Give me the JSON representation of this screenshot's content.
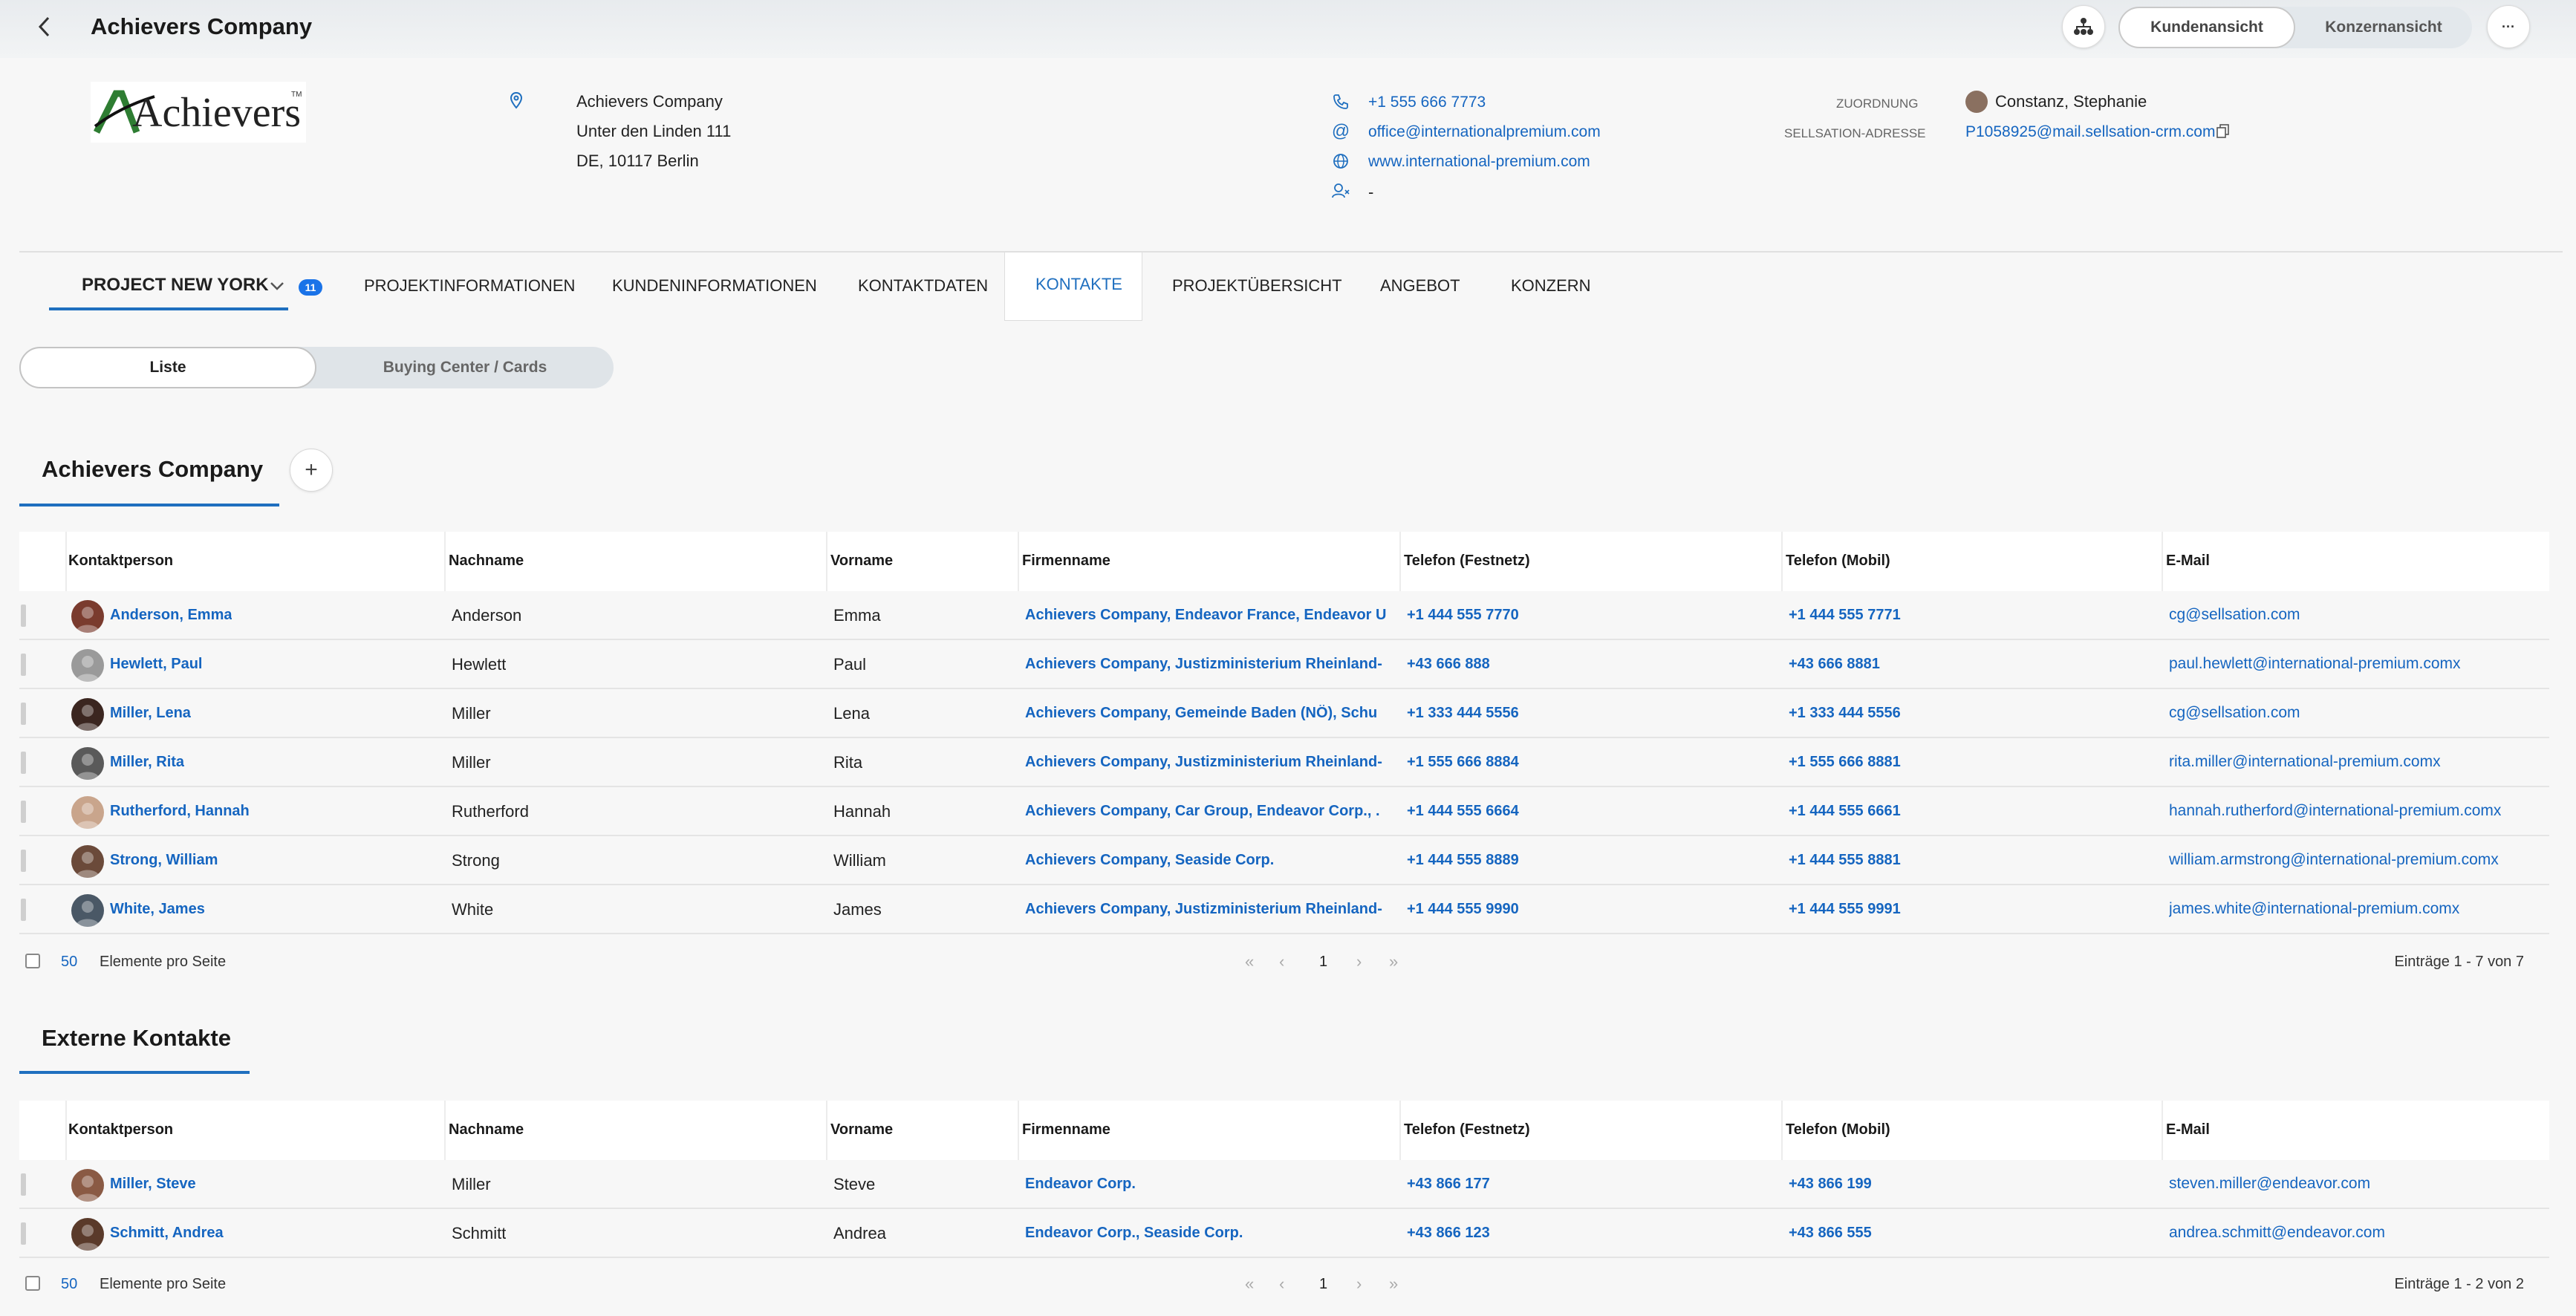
{
  "header": {
    "title": "Achievers Company",
    "view_toggle": [
      "Kundenansicht",
      "Konzernansicht"
    ],
    "more_label": "···"
  },
  "company": {
    "logo_text": "Achievers",
    "logo_tm": "TM",
    "address": [
      "Achievers Company",
      "Unter den Linden 111",
      "DE, 10117 Berlin"
    ],
    "phone": "+1 555 666 7773",
    "email": "office@internationalpremium.com",
    "website": "www.international-premium.com",
    "contact_person": "-",
    "assignment_label": "ZUORDNUNG",
    "assignment_value": "Constanz, Stephanie",
    "sellsation_label": "SELLSATION-ADRESSE",
    "sellsation_value": "P1058925@mail.sellsation-crm.com"
  },
  "tabs": {
    "project": "PROJECT NEW YORK",
    "project_badge": "11",
    "items": [
      "PROJEKTINFORMATIONEN",
      "KUNDENINFORMATIONEN",
      "KONTAKTDATEN",
      "KONTAKTE",
      "PROJEKTÜBERSICHT",
      "ANGEBOT",
      "KONZERN"
    ],
    "active": "KONTAKTE"
  },
  "view": {
    "list": "Liste",
    "cards": "Buying Center / Cards"
  },
  "columns": [
    "Kontaktperson",
    "Nachname",
    "Vorname",
    "Firmenname",
    "Telefon (Festnetz)",
    "Telefon (Mobil)",
    "E-Mail"
  ],
  "section1": {
    "title": "Achievers Company",
    "add_label": "+",
    "rows": [
      {
        "contact": "Anderson, Emma",
        "last": "Anderson",
        "first": "Emma",
        "company": "Achievers Company,  Endeavor France,  Endeavor U",
        "phone": "+1 444 555 7770",
        "mobile": "+1 444 555 7771",
        "email": "cg@sellsation.com",
        "avatar": "#7a3b2e"
      },
      {
        "contact": "Hewlett, Paul",
        "last": "Hewlett",
        "first": "Paul",
        "company": "Achievers Company,  Justizministerium Rheinland-",
        "phone": "+43 666 888",
        "mobile": "+43 666 8881",
        "email": "paul.hewlett@international-premium.comx",
        "avatar": "#9a9a9a"
      },
      {
        "contact": "Miller, Lena",
        "last": "Miller",
        "first": "Lena",
        "company": "Achievers Company,  Gemeinde Baden (NÖ),  Schu",
        "phone": "+1 333 444 5556",
        "mobile": "+1 333 444 5556",
        "email": "cg@sellsation.com",
        "avatar": "#3b2620"
      },
      {
        "contact": "Miller, Rita",
        "last": "Miller",
        "first": "Rita",
        "company": "Achievers Company,  Justizministerium Rheinland-",
        "phone": "+1 555 666 8884",
        "mobile": "+1 555 666 8881",
        "email": "rita.miller@international-premium.comx",
        "avatar": "#5a5a5a"
      },
      {
        "contact": "Rutherford, Hannah",
        "last": "Rutherford",
        "first": "Hannah",
        "company": "Achievers Company,  Car Group,  Endeavor Corp.,  .",
        "phone": "+1 444 555 6664",
        "mobile": "+1 444 555 6661",
        "email": "hannah.rutherford@international-premium.comx",
        "avatar": "#c9a58c"
      },
      {
        "contact": "Strong, William",
        "last": "Strong",
        "first": "William",
        "company": "Achievers Company,  Seaside Corp.",
        "phone": "+1 444 555 8889",
        "mobile": "+1 444 555 8881",
        "email": "william.armstrong@international-premium.comx",
        "avatar": "#6b4a3a"
      },
      {
        "contact": "White, James",
        "last": "White",
        "first": "James",
        "company": "Achievers Company,  Justizministerium Rheinland-",
        "phone": "+1 444 555 9990",
        "mobile": "+1 444 555 9991",
        "email": "james.white@international-premium.comx",
        "avatar": "#4a5866"
      }
    ],
    "per_page": "50",
    "per_page_label": "Elemente pro Seite",
    "page": "1",
    "count": "Einträge 1 - 7 von 7"
  },
  "section2": {
    "title": "Externe Kontakte",
    "rows": [
      {
        "contact": "Miller, Steve",
        "last": "Miller",
        "first": "Steve",
        "company": "Endeavor Corp.",
        "phone": "+43 866 177",
        "mobile": "+43 866 199",
        "email": "steven.miller@endeavor.com",
        "avatar": "#8a5a44"
      },
      {
        "contact": "Schmitt, Andrea",
        "last": "Schmitt",
        "first": "Andrea",
        "company": "Endeavor Corp.,  Seaside Corp.",
        "phone": "+43 866 123",
        "mobile": "+43 866 555",
        "email": "andrea.schmitt@endeavor.com",
        "avatar": "#5a3a2a"
      }
    ],
    "per_page": "50",
    "per_page_label": "Elemente pro Seite",
    "page": "1",
    "count": "Einträge 1 - 2 von 2"
  },
  "pager_icons": [
    "first-page-icon",
    "prev-page-icon",
    "next-page-icon",
    "last-page-icon"
  ]
}
